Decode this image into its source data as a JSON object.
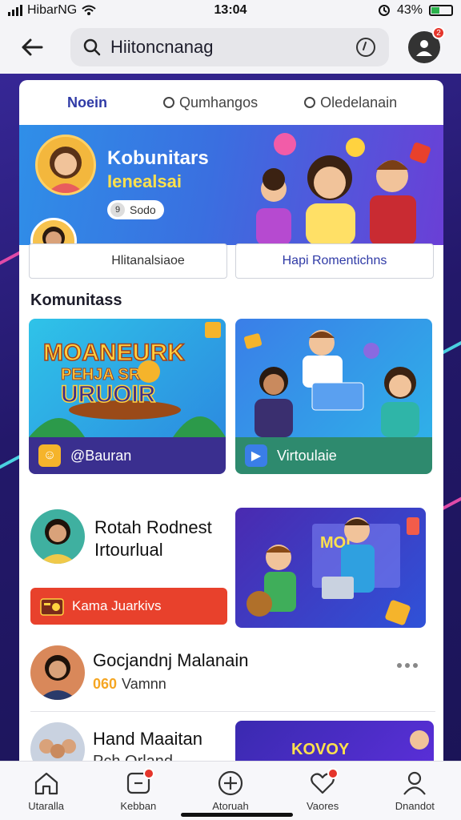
{
  "status": {
    "carrier": "HibarNG",
    "time": "13:04",
    "battery": "43%",
    "battery_level": 0.43
  },
  "search": {
    "value": "Hiitoncnanag",
    "placeholder": "Hiitoncnanag"
  },
  "profile": {
    "badge": "2"
  },
  "tabs": [
    {
      "label": "Noein"
    },
    {
      "label": "Qumhangos"
    },
    {
      "label": "Oledelanain"
    }
  ],
  "banner": {
    "title": "Kobunitars",
    "subtitle": "Ienealsai",
    "pill_label": "Sodo",
    "pill_icon": "9"
  },
  "buttons": {
    "left": "Hlitanalsiaoe",
    "right": "Hapi Romentichns"
  },
  "section_title": "Komunitass",
  "tiles": [
    {
      "art_text_1": "MOANEURK",
      "art_text_2": "PEHJA SRU",
      "art_text_3": "URUOIR",
      "footer": "@Bauran",
      "color": "#3a2f8f"
    },
    {
      "footer": "Virtoulaie",
      "color": "#2e8a6e"
    }
  ],
  "feed": [
    {
      "title": "Rotah Rodnest",
      "subtitle": "Irtourlual",
      "action": "Kama Juarkivs"
    },
    {
      "title": "Gocjandnj Malanain",
      "subtitle": "Vamnn",
      "sub_prefix": "060"
    },
    {
      "title": "Hand Maaitan",
      "subtitle": "Pch Orland",
      "preview_text": "KOVOY"
    }
  ],
  "promo_art": {
    "label": "MOI"
  },
  "bottom_nav": [
    {
      "label": "Utaralla",
      "icon": "home-icon"
    },
    {
      "label": "Kebban",
      "icon": "chat-icon",
      "badge": true
    },
    {
      "label": "Atoruah",
      "icon": "plus-circle-icon"
    },
    {
      "label": "Vaores",
      "icon": "heart-icon",
      "badge": true
    },
    {
      "label": "Dnandot",
      "icon": "person-icon"
    }
  ]
}
